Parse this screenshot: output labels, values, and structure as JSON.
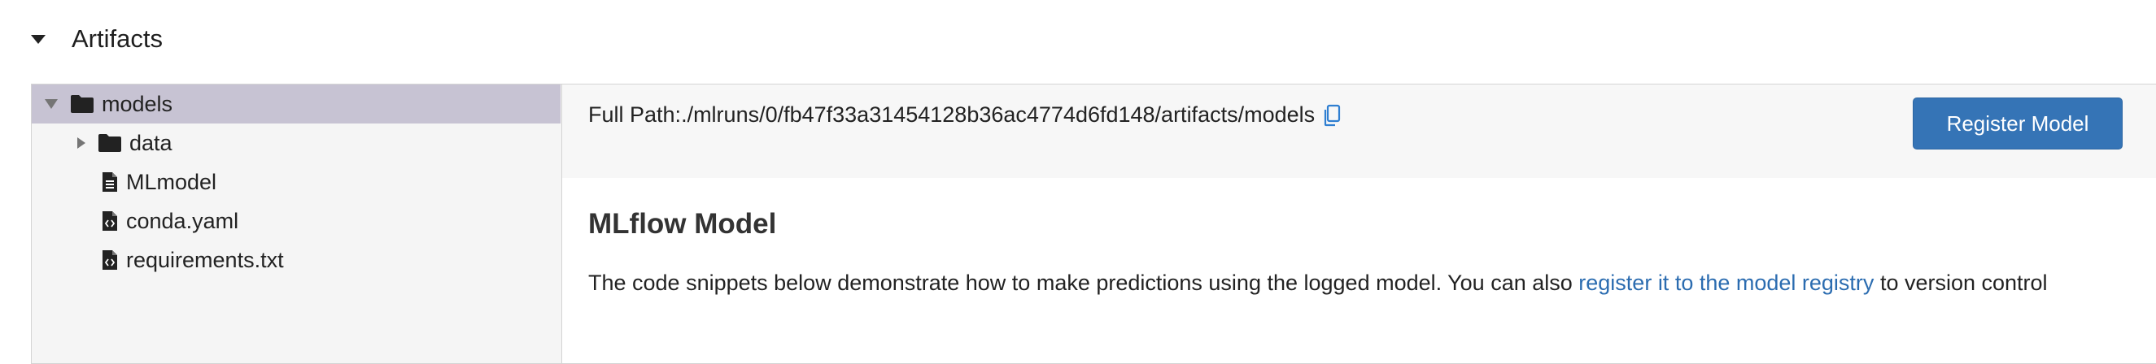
{
  "section": {
    "title": "Artifacts",
    "toggle_icon": "caret-down-icon"
  },
  "tree": {
    "items": [
      {
        "label": "models",
        "type": "folder",
        "expanded": true,
        "selected": true,
        "depth": 0
      },
      {
        "label": "data",
        "type": "folder",
        "expanded": false,
        "selected": false,
        "depth": 1
      },
      {
        "label": "MLmodel",
        "type": "file",
        "selected": false,
        "depth": 1
      },
      {
        "label": "conda.yaml",
        "type": "code-file",
        "selected": false,
        "depth": 1
      },
      {
        "label": "requirements.txt",
        "type": "code-file",
        "selected": false,
        "depth": 1
      }
    ]
  },
  "viewer": {
    "path_label": "Full Path:",
    "path_value": "./mlruns/0/fb47f33a31454128b36ac4774d6fd148/artifacts/models",
    "copy_icon": "copy-icon",
    "register_button_label": "Register Model",
    "model_heading": "MLflow Model",
    "description_before": "The code snippets below demonstrate how to make predictions using the logged model. You can also ",
    "description_link": "register it to the model registry",
    "description_after": " to version control"
  },
  "colors": {
    "selected_row": "#c7c3d3",
    "button_bg": "#3574b6",
    "link": "#2b6cb0",
    "path_bar_bg": "#f7f7f7"
  }
}
